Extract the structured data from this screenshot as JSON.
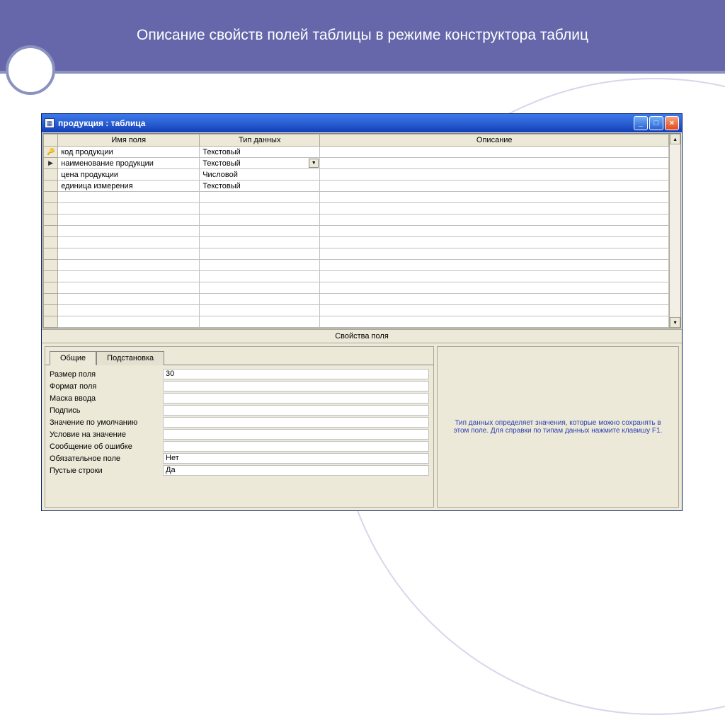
{
  "slide": {
    "title": "Описание свойств полей таблицы в режиме конструктора таблиц"
  },
  "window": {
    "title": "продукция : таблица"
  },
  "grid": {
    "headers": {
      "col1": "Имя поля",
      "col2": "Тип данных",
      "col3": "Описание"
    },
    "rows": [
      {
        "marker": "key",
        "name": "код продукции",
        "type": "Текстовый",
        "desc": ""
      },
      {
        "marker": "arrow",
        "name": "наименование продукции",
        "type": "Текстовый",
        "desc": "",
        "dropdown": true
      },
      {
        "marker": "",
        "name": "цена продукции",
        "type": "Числовой",
        "desc": ""
      },
      {
        "marker": "",
        "name": "единица измерения",
        "type": "Текстовый",
        "desc": ""
      }
    ]
  },
  "props_section_label": "Свойства поля",
  "tabs": {
    "general": "Общие",
    "lookup": "Подстановка"
  },
  "properties": [
    {
      "label": "Размер поля",
      "value": "30"
    },
    {
      "label": "Формат поля",
      "value": ""
    },
    {
      "label": "Маска ввода",
      "value": ""
    },
    {
      "label": "Подпись",
      "value": ""
    },
    {
      "label": "Значение по умолчанию",
      "value": ""
    },
    {
      "label": "Условие на значение",
      "value": ""
    },
    {
      "label": "Сообщение об ошибке",
      "value": ""
    },
    {
      "label": "Обязательное поле",
      "value": "Нет"
    },
    {
      "label": "Пустые строки",
      "value": "Да"
    }
  ],
  "help_text": "Тип данных определяет значения, которые можно сохранять в этом поле.  Для справки по типам данных нажмите клавишу F1."
}
